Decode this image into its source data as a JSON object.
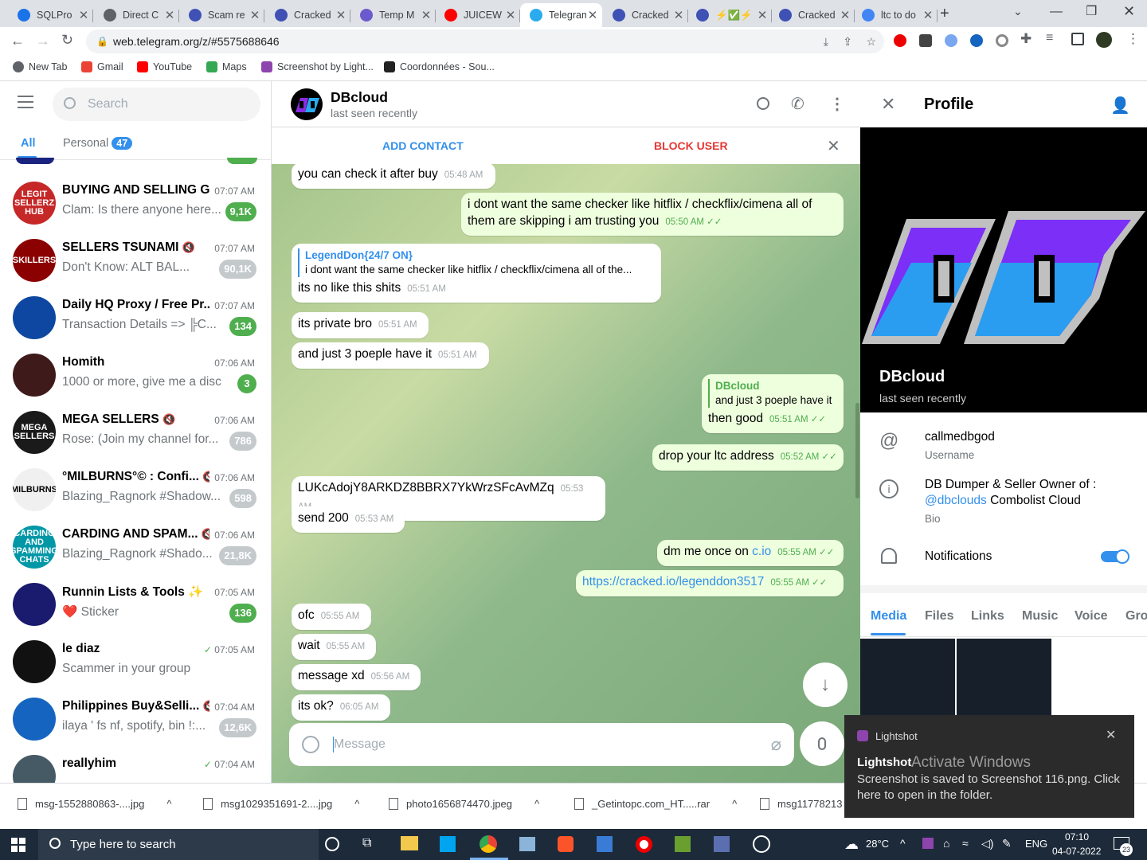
{
  "browser": {
    "tabs": [
      {
        "title": "SQLPro",
        "color": "#1a73e8"
      },
      {
        "title": "Direct C",
        "color": "#5f6368"
      },
      {
        "title": "Scam re",
        "color": "#3f51b5"
      },
      {
        "title": "Cracked",
        "color": "#3f51b5"
      },
      {
        "title": "Temp M",
        "color": "#6a5acd"
      },
      {
        "title": "JUICEW",
        "color": "#ff0000"
      },
      {
        "title": "Telegram",
        "color": "#2aabee"
      },
      {
        "title": "Cracked",
        "color": "#3f51b5"
      },
      {
        "title": "⚡✅⚡",
        "color": "#3f51b5"
      },
      {
        "title": "Cracked",
        "color": "#3f51b5"
      },
      {
        "title": "ltc to do",
        "color": "#4285f4"
      }
    ],
    "url": "web.telegram.org/z/#5575688646",
    "bookmarks": [
      "New Tab",
      "Gmail",
      "YouTube",
      "Maps",
      "Screenshot by Light...",
      "Coordonnées - Sou..."
    ]
  },
  "sidebar": {
    "search_placeholder": "Search",
    "tabs": [
      {
        "label": "All"
      },
      {
        "label": "Personal",
        "badge": "47"
      }
    ],
    "chats": [
      {
        "name": "BUYING AND SELLING G...",
        "time": "07:07 AM",
        "preview": "Clam: Is there anyone here...",
        "badge": "9,1K",
        "muted": false,
        "avatar": "LEGIT SELLERZ HUB",
        "color": "#c62828"
      },
      {
        "name": "SELLERS TSUNAMI",
        "time": "07:07 AM",
        "preview": "Don't Know: ALT BAL...",
        "badge": "90,1K",
        "muted": true,
        "avatar": "SKILLERS",
        "color": "#8b0000"
      },
      {
        "name": "Daily HQ Proxy / Free Pr...",
        "time": "07:07 AM",
        "preview": "Transaction Details => ╠C...",
        "badge": "134",
        "muted": false,
        "avatar": "",
        "color": "#0d47a1"
      },
      {
        "name": "Homith",
        "time": "07:06 AM",
        "preview": "1000 or more, give me a disc...",
        "badge": "3",
        "muted": false,
        "avatar": "",
        "color": "#3e1a1a"
      },
      {
        "name": "MEGA SELLERS",
        "time": "07:06 AM",
        "preview": "Rose: (Join my channel for...",
        "badge": "786",
        "muted": true,
        "avatar": "MEGA SELLERS",
        "color": "#1a1a1a"
      },
      {
        "name": "°MILBURNS°© : Confi...",
        "time": "07:06 AM",
        "preview": "Blazing_Ragnork #Shadow...",
        "badge": "598",
        "muted": true,
        "avatar": "MILBURNS",
        "color": "#f0f0f0"
      },
      {
        "name": "CARDING AND SPAM...",
        "time": "07:06 AM",
        "preview": "Blazing_Ragnork #Shado...",
        "badge": "21,8K",
        "muted": true,
        "avatar": "CARDING AND SPAMMING CHATS",
        "color": "#0097a7"
      },
      {
        "name": "Runnin Lists & Tools ✨",
        "time": "07:05 AM",
        "preview": "❤️ Sticker",
        "badge": "136",
        "muted": false,
        "avatar": "",
        "color": "#1a1a6e"
      },
      {
        "name": "le diaz",
        "time": "07:05 AM",
        "preview": "Scammer in your group",
        "badge": "",
        "muted": false,
        "avatar": "",
        "color": "#111111"
      },
      {
        "name": "Philippines Buy&Selli...",
        "time": "07:04 AM",
        "preview": "ilaya ' fs nf, spotify, bin !:...",
        "badge": "12,6K",
        "muted": true,
        "avatar": "",
        "color": "#1565c0"
      },
      {
        "name": "reallyhim",
        "time": "07:04 AM",
        "preview": "",
        "badge": "",
        "muted": false,
        "avatar": "",
        "color": "#455a64"
      }
    ]
  },
  "chat": {
    "title": "DBcloud",
    "status": "last seen recently",
    "add_contact": "ADD CONTACT",
    "block_user": "BLOCK USER",
    "composer_placeholder": "Message",
    "messages": [
      {
        "dir": "in",
        "text": "you can check it after buy",
        "time": "05:48 AM"
      },
      {
        "dir": "out",
        "text": "i dont want the same checker like hitflix / checkflix/cimena all of them are skipping i am trusting you",
        "time": "05:50 AM"
      },
      {
        "dir": "in",
        "reply_name": "LegendDon{24/7 ON}",
        "reply_text": "i dont want the same checker like hitflix / checkflix/cimena all of the...",
        "text": "its no like this shits",
        "time": "05:51 AM"
      },
      {
        "dir": "in",
        "text": "its private bro",
        "time": "05:51 AM"
      },
      {
        "dir": "in",
        "text": "and just 3 poeple have it",
        "time": "05:51 AM"
      },
      {
        "dir": "out",
        "reply_name": "DBcloud",
        "reply_text": "and just 3 poeple have it",
        "text": "then good",
        "time": "05:51 AM"
      },
      {
        "dir": "out",
        "text": "drop your ltc address",
        "time": "05:52 AM"
      },
      {
        "dir": "in",
        "text": "LUKcAdojY8ARKDZ8BBRX7YkWrzSFcAvMZq",
        "time": "05:53 AM"
      },
      {
        "dir": "in",
        "text": "send 200",
        "time": "05:53 AM"
      },
      {
        "dir": "out",
        "text": "dm me once on",
        "link": "c.io",
        "time": "05:55 AM"
      },
      {
        "dir": "out",
        "link": "https://cracked.io/legenddon3517",
        "time": "05:55 AM"
      },
      {
        "dir": "in",
        "text": "ofc",
        "time": "05:55 AM"
      },
      {
        "dir": "in",
        "text": "wait",
        "time": "05:55 AM"
      },
      {
        "dir": "in",
        "text": "message xd",
        "time": "05:56 AM"
      },
      {
        "dir": "in",
        "text": "its ok?",
        "time": "06:05 AM"
      }
    ]
  },
  "profile": {
    "header": "Profile",
    "name": "DBcloud",
    "status": "last seen recently",
    "username": "callmedbgod",
    "username_label": "Username",
    "bio_line1": "DB Dumper & Seller Owner of :",
    "bio_link": "@dbclouds",
    "bio_rest": "Combolist Cloud",
    "bio_label": "Bio",
    "notifications_label": "Notifications",
    "notifications_on": true,
    "media_tabs": [
      "Media",
      "Files",
      "Links",
      "Music",
      "Voice",
      "Gro"
    ]
  },
  "downloads": [
    "msg-1552880863-....jpg",
    "msg1029351691-2....jpg",
    "photo1656874470.jpeg",
    "_Getintopc.com_HT.....rar",
    "msg11778213"
  ],
  "toast": {
    "app": "Lightshot",
    "title": "Lightshot",
    "watermark": "Activate Windows",
    "body": "Screenshot is saved to Screenshot 116.png. Click here to open in the folder."
  },
  "taskbar": {
    "search_placeholder": "Type here to search",
    "weather": "28°C",
    "lang": "ENG",
    "time": "07:10",
    "date": "04-07-2022",
    "notif_count": "23"
  }
}
